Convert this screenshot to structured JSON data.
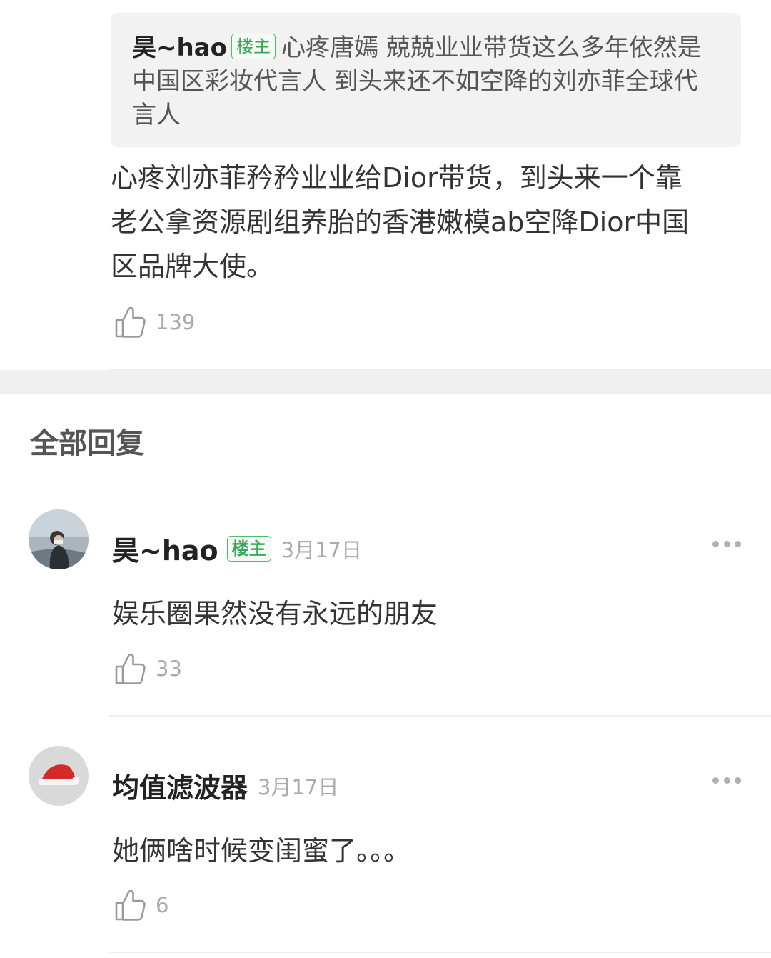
{
  "quoted": {
    "author": "昊~hao",
    "badge": "楼主",
    "text": "心疼唐嫣 兢兢业业带货这么多年依然是中国区彩妆代言人 到头来还不如空降的刘亦菲全球代言人"
  },
  "top_reply": {
    "line1": "心疼刘亦菲矜矜业业给Dior带货，到头来一个靠",
    "line2": "老公拿资源剧组养胎的香港嫩模ab空降Dior中国",
    "line3": "区品牌大使。",
    "likes": "139"
  },
  "section_title": "全部回复",
  "replies": [
    {
      "author": "昊~hao",
      "badge": "楼主",
      "date": "3月17日",
      "text": "娱乐圈果然没有永远的朋友",
      "likes": "33",
      "avatar_icon": "avatar-photo-person"
    },
    {
      "author": "均值滤波器",
      "date": "3月17日",
      "text": "她俩啥时候变闺蜜了。。。",
      "likes": "6",
      "avatar_icon": "avatar-santa-hat"
    }
  ],
  "colors": {
    "badge_green": "#3aa85a",
    "quote_bg": "#f2f2f2",
    "muted": "#aaaaaa"
  }
}
